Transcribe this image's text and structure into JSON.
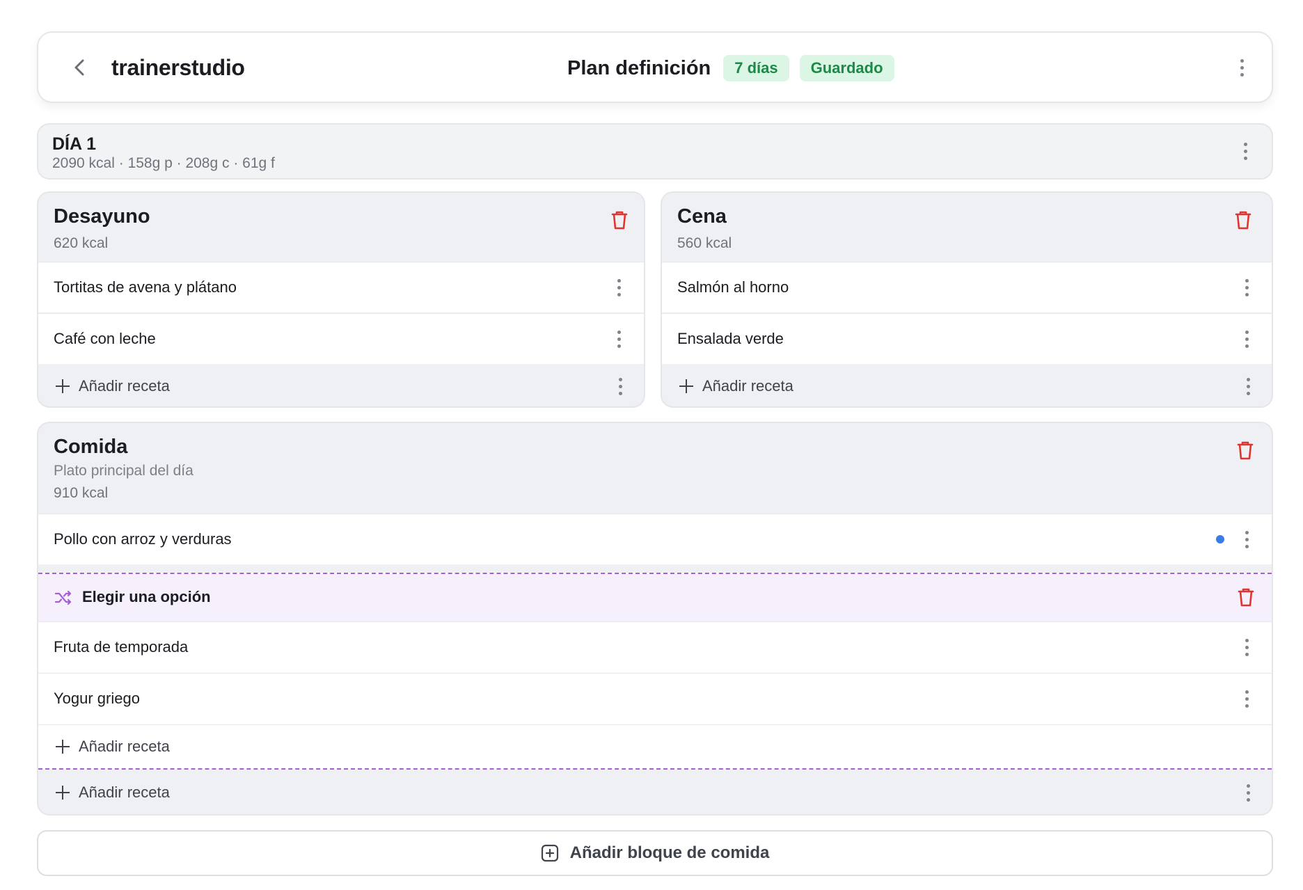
{
  "header": {
    "brand": "trainerstudio",
    "plan_title": "Plan definición",
    "badges": [
      "7 días",
      "Guardado"
    ]
  },
  "day": {
    "title": "DÍA 1",
    "macros": "2090 kcal · 158g p · 208g c · 61g f"
  },
  "meals": {
    "desayuno": {
      "title": "Desayuno",
      "kcal": "620 kcal",
      "recipes": [
        "Tortitas de avena y plátano",
        "Café con leche"
      ],
      "add_label": "Añadir receta"
    },
    "cena": {
      "title": "Cena",
      "kcal": "560 kcal",
      "recipes": [
        "Salmón al horno",
        "Ensalada verde"
      ],
      "add_label": "Añadir receta"
    },
    "comida": {
      "title": "Comida",
      "subtitle": "Plato principal del día",
      "kcal": "910 kcal",
      "recipes": [
        "Pollo con arroz y verduras"
      ],
      "option_group": {
        "label": "Elegir una opción",
        "recipes": [
          "Fruta de temporada",
          "Yogur griego"
        ],
        "add_label": "Añadir receta"
      },
      "add_label": "Añadir receta"
    }
  },
  "add_block_label": "Añadir bloque de comida",
  "colors": {
    "accent_green_bg": "#dcf6e5",
    "accent_green_text": "#1c8a47",
    "delete_red": "#e0352f",
    "option_purple": "#a55ed6",
    "unsaved_dot_blue": "#3b7be9"
  },
  "icons": {
    "back": "chevron-left-icon",
    "menu": "kebab-icon",
    "delete": "trash-icon",
    "add": "plus-icon",
    "option": "shuffle-icon",
    "add_block": "plus-square-icon"
  }
}
